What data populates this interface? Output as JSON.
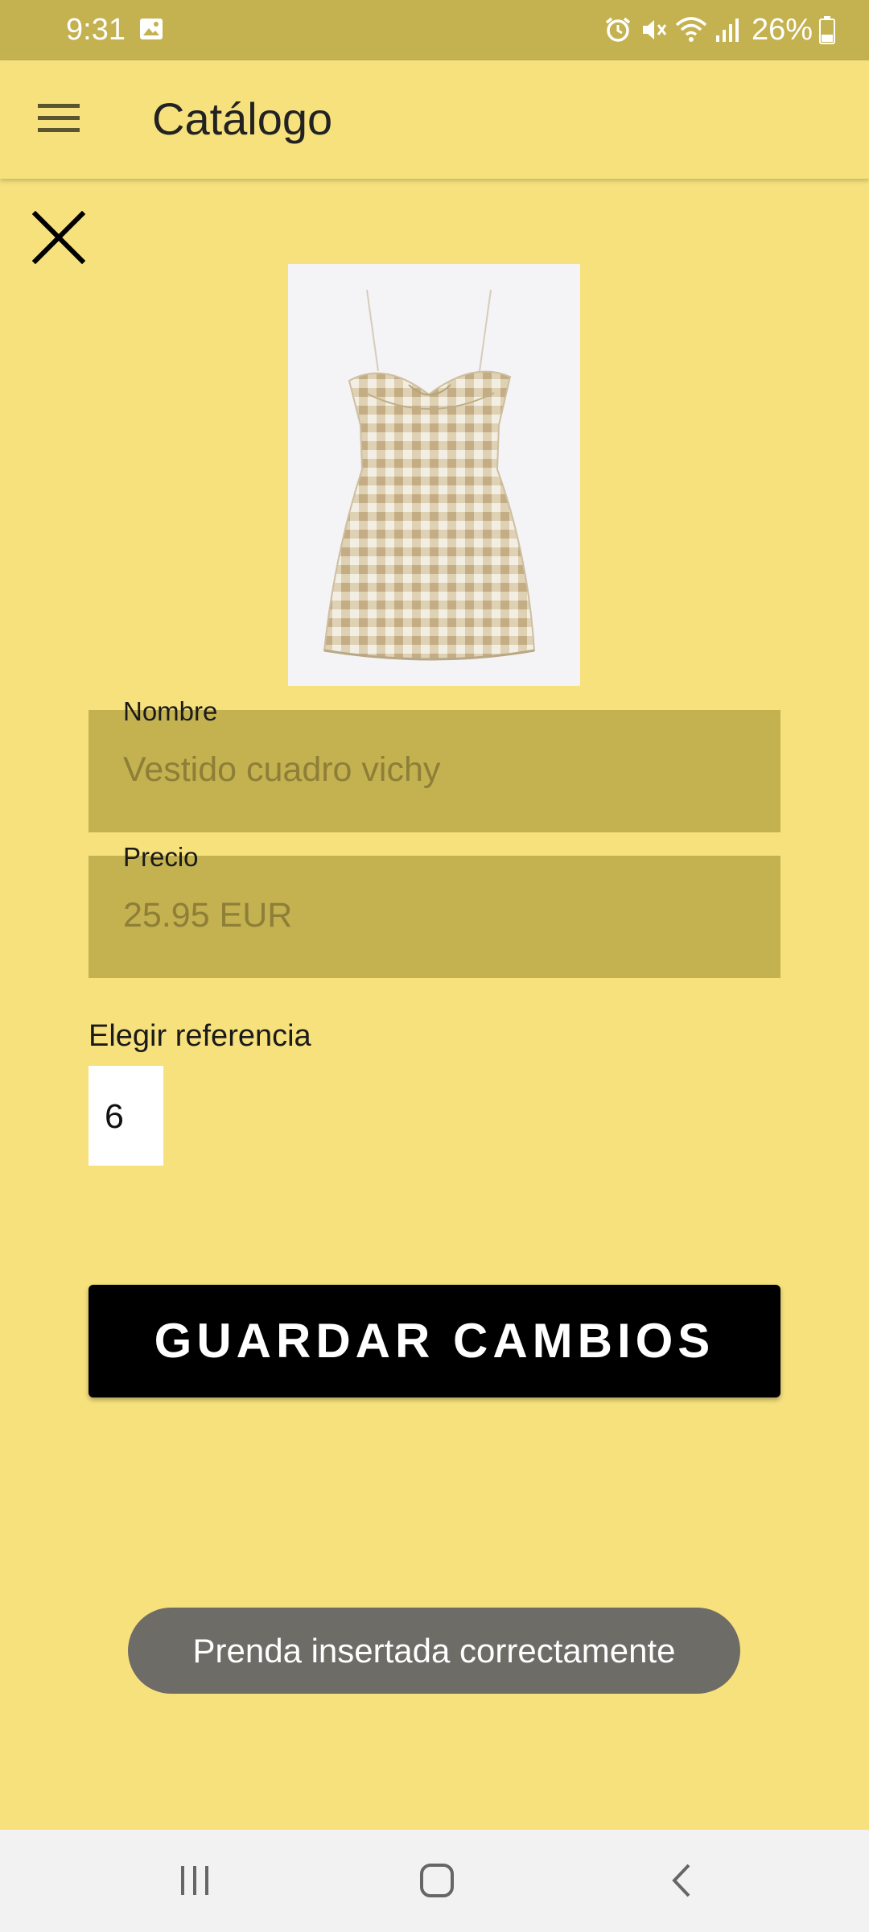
{
  "status_bar": {
    "time": "9:31",
    "battery": "26%",
    "icons": [
      "gallery-icon",
      "alarm-icon",
      "mute-icon",
      "wifi-icon",
      "signal-icon",
      "battery-icon"
    ]
  },
  "app_bar": {
    "title": "Catálogo",
    "menu_icon": "menu-icon"
  },
  "product": {
    "close_icon": "close-icon",
    "image": "checked-dress-image",
    "fields": {
      "name": {
        "label": "Nombre",
        "placeholder": "Vestido cuadro vichy",
        "value": ""
      },
      "price": {
        "label": "Precio",
        "placeholder": "25.95 EUR",
        "value": ""
      }
    },
    "reference": {
      "label": "Elegir referencia",
      "selected": "6"
    },
    "save_label": "GUARDAR CAMBIOS"
  },
  "toast": {
    "message": "Prenda insertada correctamente"
  },
  "nav_bar": {
    "buttons": [
      "recent-apps-icon",
      "home-icon",
      "back-icon"
    ]
  },
  "colors": {
    "background": "#F6E17D",
    "status_bar": "#C4B150",
    "field_background": "#C4B150",
    "field_text": "#8E7F38",
    "button": "#000000",
    "toast": "#6E6C67",
    "nav_bar": "#F2F2F2"
  }
}
